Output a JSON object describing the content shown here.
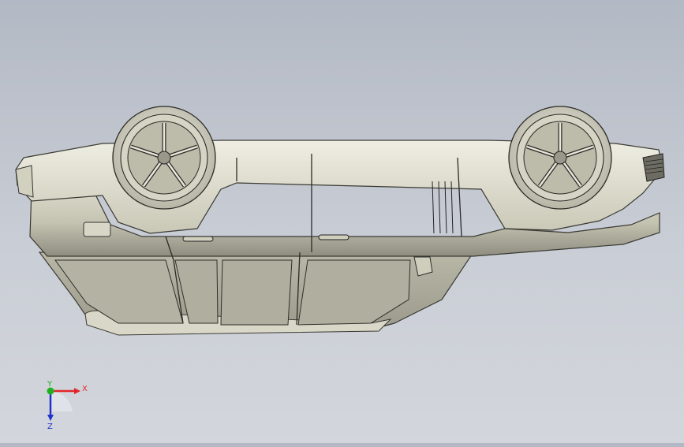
{
  "viewport": {
    "background_top": "#b3b9c4",
    "background_bottom": "#d3d6dc",
    "model": "car-body-upside-down"
  },
  "triad": {
    "x_label": "X",
    "y_label": "Y",
    "z_label": "Z",
    "x_color": "#e0262a",
    "y_color": "#20b020",
    "z_color": "#2233cc"
  }
}
